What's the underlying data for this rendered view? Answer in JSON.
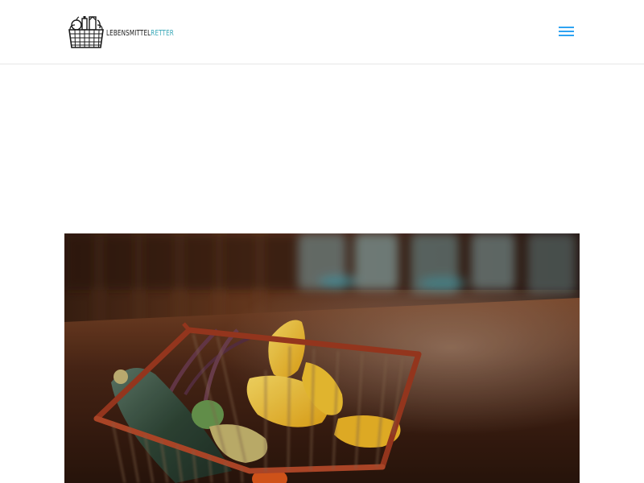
{
  "header": {
    "logo": {
      "text_main": "LEBENSMITTEL",
      "text_accent": "RETTER",
      "accent_color": "#3aa8b8",
      "icon": "shopping-basket-logo-icon"
    },
    "menu": {
      "icon": "hamburger-menu-icon",
      "color": "#2ea3f2"
    }
  },
  "hero": {
    "image": "basket-of-vegetables-photo"
  }
}
